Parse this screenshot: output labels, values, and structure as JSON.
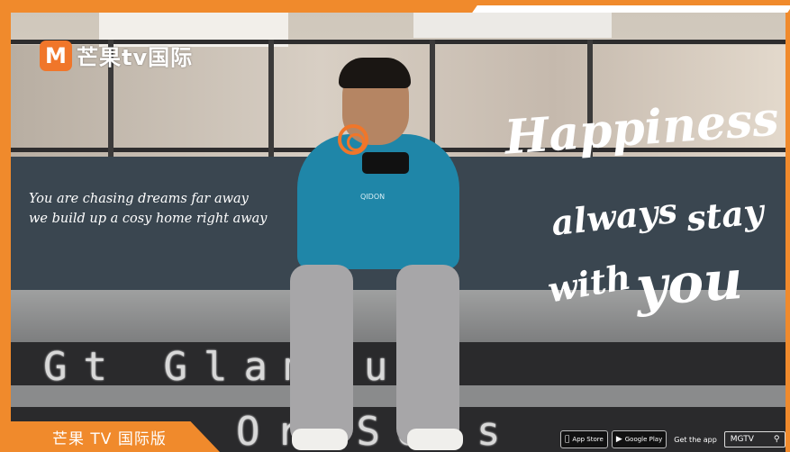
{
  "brand": {
    "logo_mark": "M",
    "logo_text": "芒果tv国际",
    "accent_color": "#f08a2c"
  },
  "tagline": {
    "line1": "You are chasing dreams far away",
    "line2": "we build up a cosy home right away"
  },
  "headline": {
    "word1": "Happiness",
    "word2": "always",
    "word3": "stay",
    "word4": "with",
    "word5": "you"
  },
  "led_signs": {
    "upper": "Gt Glamour",
    "lower": "Or Sous"
  },
  "shirt_text": "QIDON",
  "bottom_tag": "芒果 TV 国际版",
  "store_badges": {
    "app_store": "App Store",
    "google_play": "Google Play",
    "get_app": "Get the app",
    "search_label": "MGTV",
    "search_icon": "search-icon",
    "apple_icon": "apple-icon",
    "play_icon": "play-icon"
  }
}
